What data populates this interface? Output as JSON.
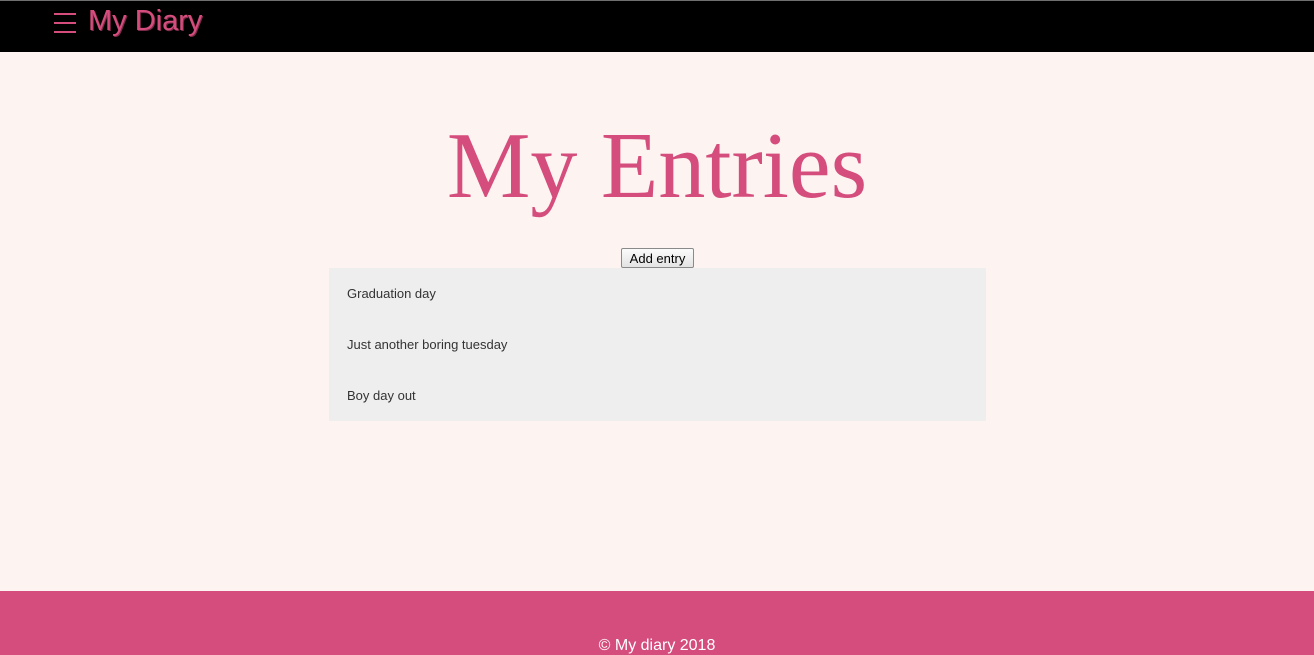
{
  "header": {
    "menu_icon": "hamburger-menu-icon",
    "brand": "My Diary"
  },
  "main": {
    "title": "My Entries",
    "add_button_label": "Add entry",
    "entries": [
      "Graduation day",
      "Just another boring tuesday",
      "Boy day out"
    ]
  },
  "footer": {
    "text": "© My diary 2018"
  },
  "colors": {
    "accent": "#d44d7c",
    "background": "#fdf3f0",
    "topbar": "#000000",
    "entries_background": "#eeeeee"
  }
}
